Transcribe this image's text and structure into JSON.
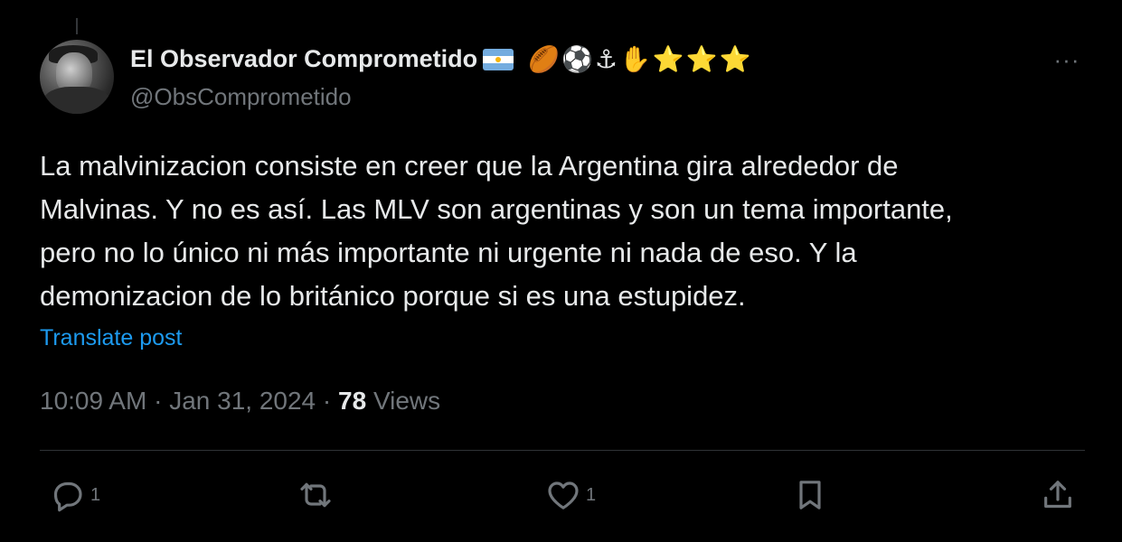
{
  "post": {
    "author": {
      "display_name": "El Observador Comprometido",
      "handle": "@ObsComprometido",
      "name_emojis": [
        "🏉",
        "⚽",
        "⚓",
        "✋",
        "⭐",
        "⭐",
        "⭐"
      ]
    },
    "text_lines": [
      "La malvinizacion consiste en creer que la Argentina gira alrededor de",
      "Malvinas. Y no es así. Las MLV son argentinas y son un tema importante,",
      "pero no lo único ni más importante ni urgente ni nada de eso. Y la",
      "demonizacion de lo británico porque si es una estupidez."
    ],
    "translate_label": "Translate post",
    "time": "10:09 AM",
    "date": "Jan 31, 2024",
    "separator": "·",
    "views_count": "78",
    "views_label": "Views",
    "more_label": "···"
  },
  "actions": {
    "reply_count": "1",
    "repost_count": "",
    "like_count": "1"
  },
  "colors": {
    "background": "#000000",
    "text": "#e7e9ea",
    "muted": "#71767b",
    "link": "#1d9bf0",
    "divider": "#2f3336"
  }
}
